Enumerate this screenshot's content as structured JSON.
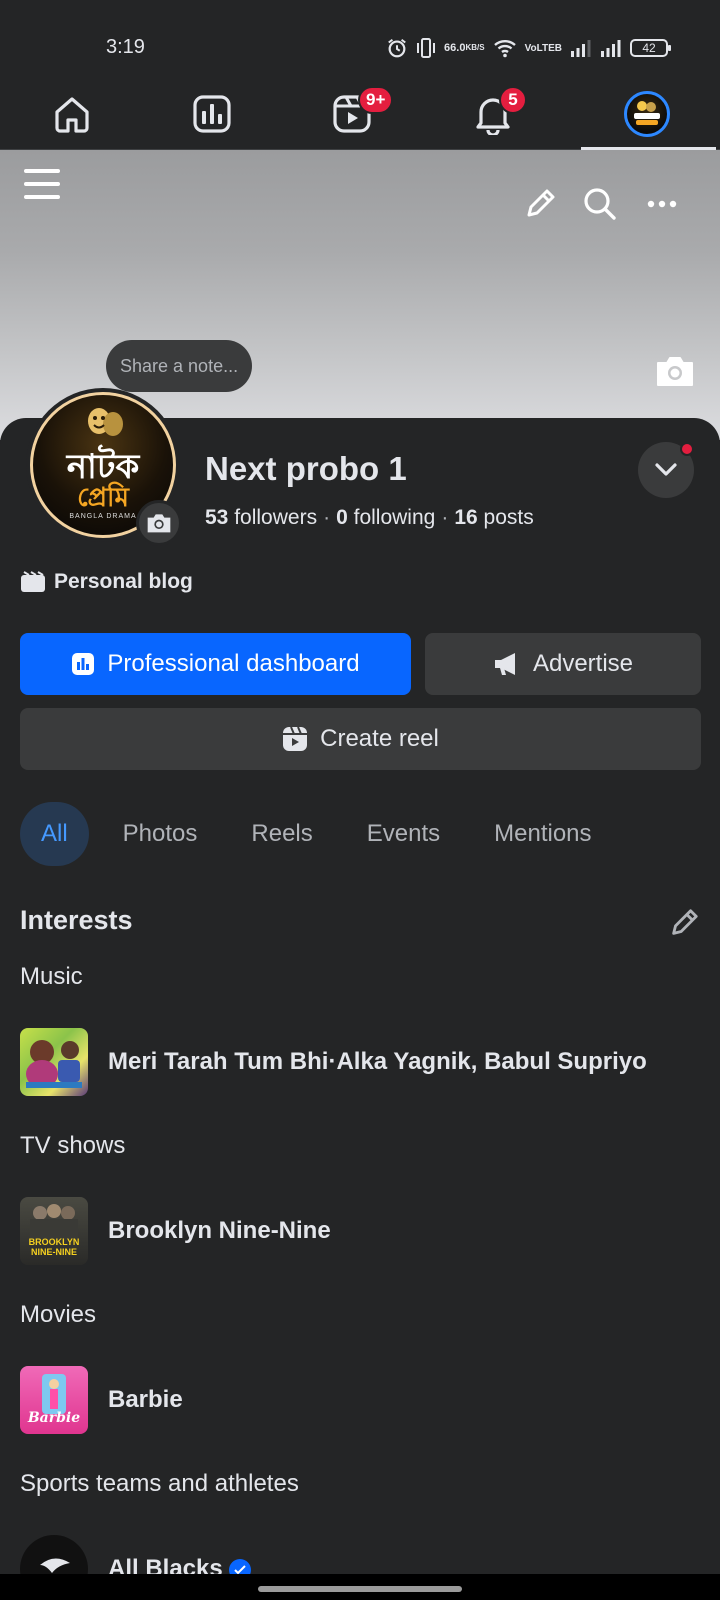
{
  "status_bar": {
    "time": "3:19",
    "speed_value": "66.0",
    "speed_unit": "KB/S",
    "volte_top": "Vo",
    "volte_bottom": "LTEB",
    "battery": "42"
  },
  "nav": {
    "items": [
      {
        "icon": "home-icon"
      },
      {
        "icon": "dashboard-icon"
      },
      {
        "icon": "reels-icon",
        "badge": "9+"
      },
      {
        "icon": "bell-icon",
        "badge": "5"
      },
      {
        "icon": "profile-avatar",
        "active": true
      }
    ]
  },
  "cover": {
    "note_placeholder": "Share a note..."
  },
  "profile": {
    "name": "Next probo 1",
    "logo_line1": "নাটক",
    "logo_line2": "প্রেমি",
    "logo_sub": "BANGLA DRAMA",
    "followers_count": "53",
    "followers_label": "followers",
    "following_count": "0",
    "following_label": "following",
    "posts_count": "16",
    "posts_label": "posts",
    "separator": "·",
    "category": "Personal blog"
  },
  "actions": {
    "professional_dashboard": "Professional dashboard",
    "advertise": "Advertise",
    "create_reel": "Create reel"
  },
  "tabs": [
    "All",
    "Photos",
    "Reels",
    "Events",
    "Mentions"
  ],
  "interests": {
    "title": "Interests",
    "groups": [
      {
        "label": "Music",
        "item": "Meri Tarah Tum Bhi·Alka Yagnik, Babul Supriyo"
      },
      {
        "label": "TV shows",
        "item": "Brooklyn Nine-Nine",
        "thumb_text": "BROOKLYN NINE-NINE"
      },
      {
        "label": "Movies",
        "item": "Barbie",
        "thumb_text": "Barbie"
      },
      {
        "label": "Sports teams and athletes",
        "item": "All Blacks"
      }
    ]
  },
  "colors": {
    "background": "#242526",
    "primary": "#0866ff",
    "secondary_button": "#3a3b3c",
    "badge": "#e41e3f",
    "active_tab_bg": "#263951",
    "active_tab_text": "#4599ff"
  }
}
